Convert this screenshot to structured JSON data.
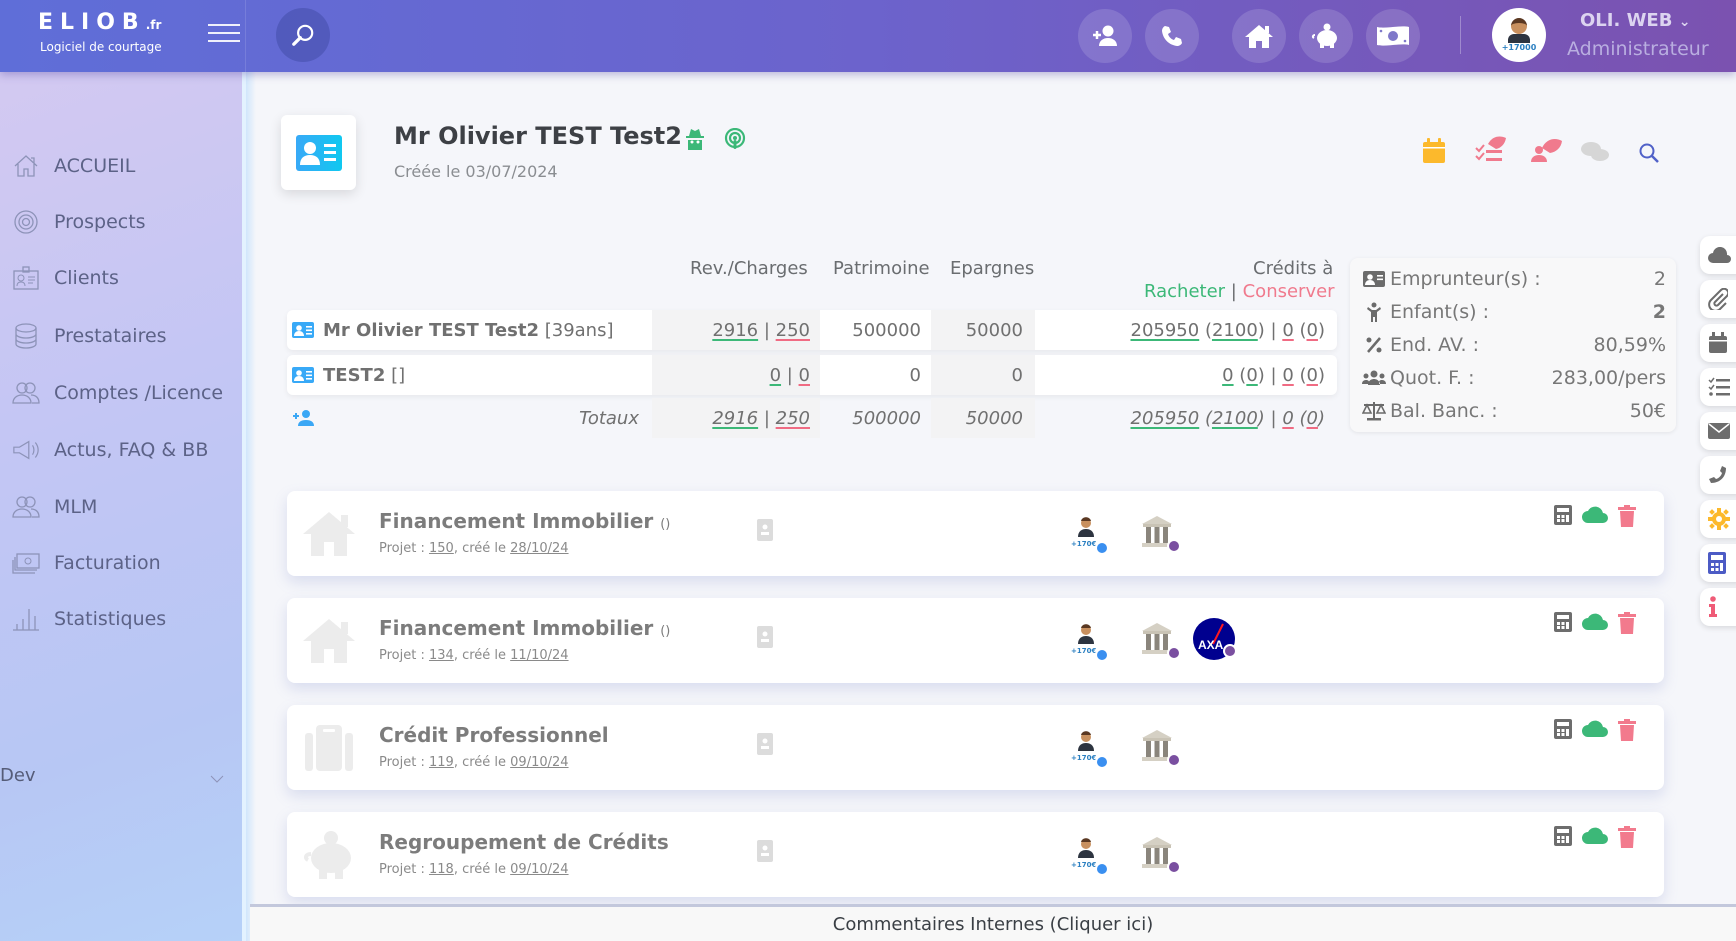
{
  "brand": {
    "name": "ELIOB",
    "tld": ".fr",
    "tagline": "Logiciel de courtage"
  },
  "topbar": {
    "quick_actions": [
      {
        "icon": "user-plus-icon",
        "label": "Ajouter un contact"
      },
      {
        "icon": "phone-icon",
        "label": "Appel"
      },
      {
        "icon": "home-icon",
        "label": "Immobilier"
      },
      {
        "icon": "piggy-bank-icon",
        "label": "Epargne"
      },
      {
        "icon": "money-bill-icon",
        "label": "Facturation"
      }
    ],
    "avatar_badge": "+17000",
    "user_name": "OLI. WEB",
    "user_role": "Administrateur"
  },
  "sidebar": {
    "items": [
      {
        "label": "ACCUEIL",
        "icon": "home-icon"
      },
      {
        "label": "Prospects",
        "icon": "target-icon"
      },
      {
        "label": "Clients",
        "icon": "id-badge-icon"
      },
      {
        "label": "Prestataires",
        "icon": "database-icon"
      },
      {
        "label": "Comptes /Licence",
        "icon": "users-icon"
      },
      {
        "label": "Actus, FAQ & BB",
        "icon": "megaphone-icon"
      },
      {
        "label": "MLM",
        "icon": "users-icon"
      },
      {
        "label": "Facturation",
        "icon": "money-stack-icon"
      },
      {
        "label": "Statistiques",
        "icon": "bar-chart-icon"
      }
    ],
    "section": "Dev"
  },
  "client": {
    "name": "Mr Olivier TEST Test2",
    "created": "Créée le 03/07/2024",
    "colors": {
      "status": "#3cb878",
      "accent": "#4aaaf5"
    }
  },
  "table": {
    "headers": {
      "rev": "Rev./Charges",
      "patrimoine": "Patrimoine",
      "epargnes": "Epargnes",
      "credits": "Crédits à",
      "racheter": "Racheter",
      "sep": "|",
      "conserver": "Conserver"
    },
    "rows": [
      {
        "name": "Mr Olivier TEST Test2",
        "extra": "[39ans]",
        "rev": "2916",
        "charges": "250",
        "patrimoine": "500000",
        "epargnes": "50000",
        "rach": "205950",
        "rach_m": "2100",
        "cons": "0",
        "cons_m": "0"
      },
      {
        "name": "TEST2",
        "extra": "[]",
        "rev": "0",
        "charges": "0",
        "patrimoine": "0",
        "epargnes": "0",
        "rach": "0",
        "rach_m": "0",
        "cons": "0",
        "cons_m": "0"
      }
    ],
    "totals": {
      "label": "Totaux",
      "rev": "2916",
      "charges": "250",
      "patrimoine": "500000",
      "epargnes": "50000",
      "rach": "205950",
      "rach_m": "2100",
      "cons": "0",
      "cons_m": "0"
    }
  },
  "stats": [
    {
      "label": "Emprunteur(s) :",
      "value": "2",
      "icon": "id-card-icon"
    },
    {
      "label": "Enfant(s) :",
      "value": "2",
      "icon": "child-icon"
    },
    {
      "label": "End. AV. :",
      "value": "80,59%",
      "icon": "percent-icon"
    },
    {
      "label": "Quot. F. :",
      "value": "283,00/pers",
      "icon": "users-icon"
    },
    {
      "label": "Bal. Banc. :",
      "value": "50€",
      "icon": "balance-scale-icon"
    }
  ],
  "projects": [
    {
      "title": "Financement Immobilier",
      "suffix": "()",
      "prefix": "Projet : ",
      "id": "150",
      "mid": ", créé le ",
      "date": "28/10/24",
      "icon": "home-icon",
      "insurer": false
    },
    {
      "title": "Financement Immobilier",
      "suffix": "()",
      "prefix": "Projet : ",
      "id": "134",
      "mid": ", créé le ",
      "date": "11/10/24",
      "icon": "home-icon",
      "insurer": true
    },
    {
      "title": "Crédit Professionnel",
      "suffix": "",
      "prefix": "Projet : ",
      "id": "119",
      "mid": ", créé le ",
      "date": "09/10/24",
      "icon": "briefcase-icon",
      "insurer": false
    },
    {
      "title": "Regroupement de Crédits",
      "suffix": "",
      "prefix": "Projet : ",
      "id": "118",
      "mid": ", créé le ",
      "date": "09/10/24",
      "icon": "piggy-bank-icon",
      "insurer": false
    }
  ],
  "project_badges": {
    "agent": "+170€",
    "bank": "BANK",
    "insurer": "AXA"
  },
  "rail": [
    "cloud-icon",
    "paperclip-icon",
    "calendar-icon",
    "tasks-icon",
    "envelope-icon",
    "phone-icon",
    "gear-icon",
    "calculator-icon",
    "info-icon"
  ],
  "comment_bar": "Commentaires Internes (Cliquer ici)"
}
